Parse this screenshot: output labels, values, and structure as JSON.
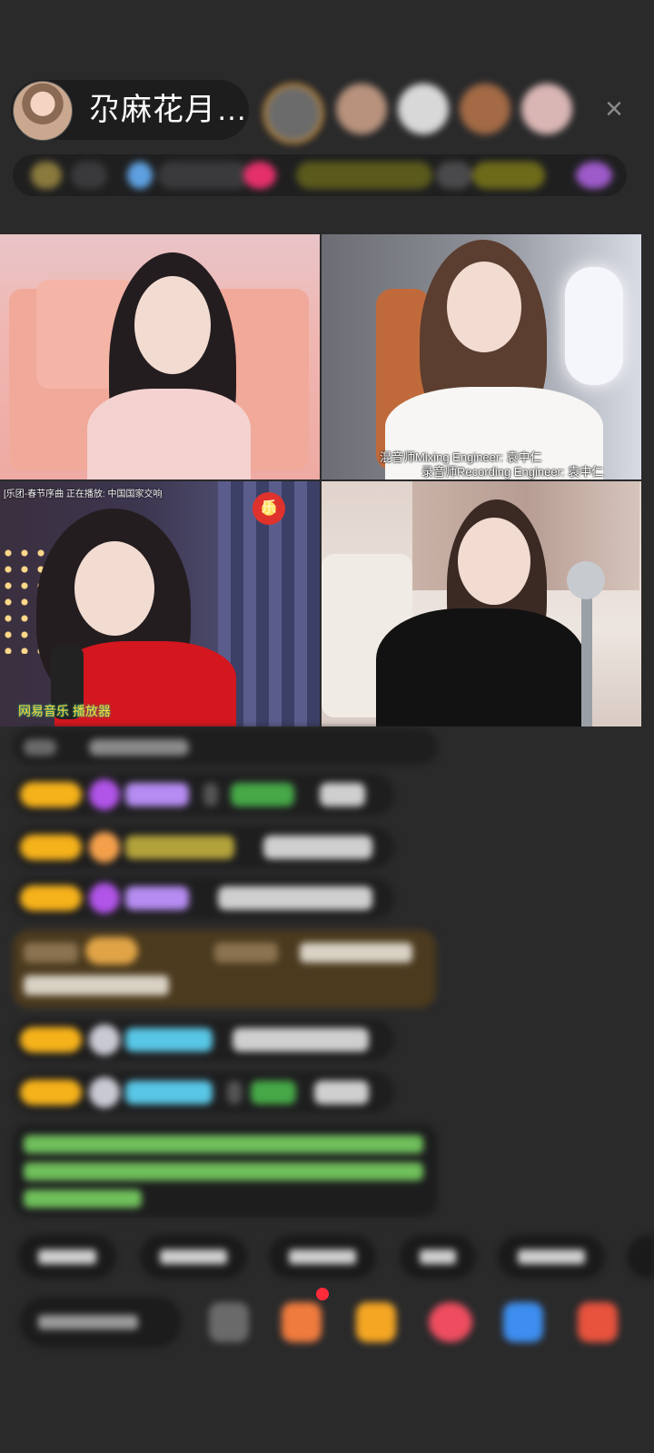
{
  "header": {
    "host_name": "尕麻花月…",
    "close_glyph": "×"
  },
  "video": {
    "cell2_caption_1": "混音师Mixing Engineer: 袁中仁",
    "cell2_caption_2": "录音师Recording Engineer: 袁中仁",
    "cell3_overlay": "[乐团-春节序曲 正在播放: 中国国家交响",
    "cell3_badge": "乐",
    "cell3_logo": "网易音乐 播放器"
  },
  "colors": {
    "background": "#2a2a2b",
    "level_badge": "#f6b21a",
    "gold_bubble": "#4b3a1e",
    "green_text": "#7bd56a",
    "cyan_name": "#58c6e6",
    "purple_name": "#b58cf2"
  },
  "icons": [
    "close-icon",
    "gem-icon",
    "heart-icon",
    "gift-icon",
    "emoji-icon"
  ]
}
